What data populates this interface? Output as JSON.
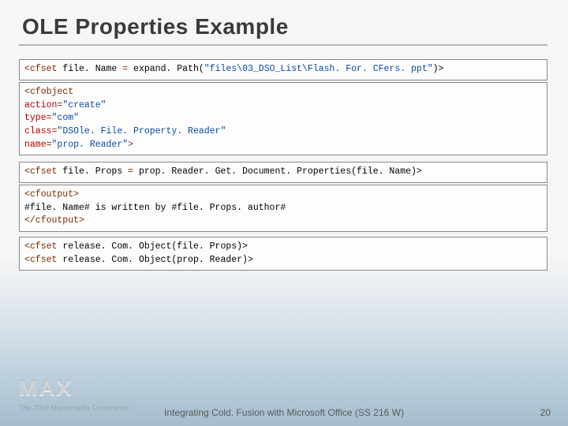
{
  "title": "OLE Properties Example",
  "code": {
    "block1": {
      "t1": "<cfset",
      "t2": " file. Name ",
      "t3": "=",
      "t4": " expand. Path(",
      "t5": "\"files\\03_DSO_List\\Flash. For. CFers. ppt\"",
      "t6": ")>"
    },
    "block2": {
      "l1": "<cfobject",
      "l2a": "   action",
      "l2b": "=",
      "l2c": "\"create\"",
      "l3a": "   type",
      "l3b": "=",
      "l3c": "\"com\"",
      "l4a": "   class",
      "l4b": "=",
      "l4c": "\"DSOle. File. Property. Reader\"",
      "l5a": "   name",
      "l5b": "=",
      "l5c": "\"prop. Reader\"",
      "l5d": ">"
    },
    "block3": {
      "t1": "<cfset",
      "t2": " file. Props ",
      "t3": "=",
      "t4": " prop. Reader. Get. Document. Properties(file. Name)>"
    },
    "block4": {
      "l1": "<cfoutput>",
      "l2": "   #file. Name# is written by #file. Props. author#",
      "l3": "</cfoutput>"
    },
    "block5": {
      "l1a": "<cfset",
      "l1b": " release. Com. Object(file. Props)>",
      "l2a": "<cfset",
      "l2b": " release. Com. Object(prop. Reader)>"
    }
  },
  "footer": {
    "logo": "MAX",
    "conference": "The 2003 Macromedia Conference",
    "center": "Integrating Cold. Fusion with Microsoft Office (SS 216 W)",
    "page": "20"
  }
}
